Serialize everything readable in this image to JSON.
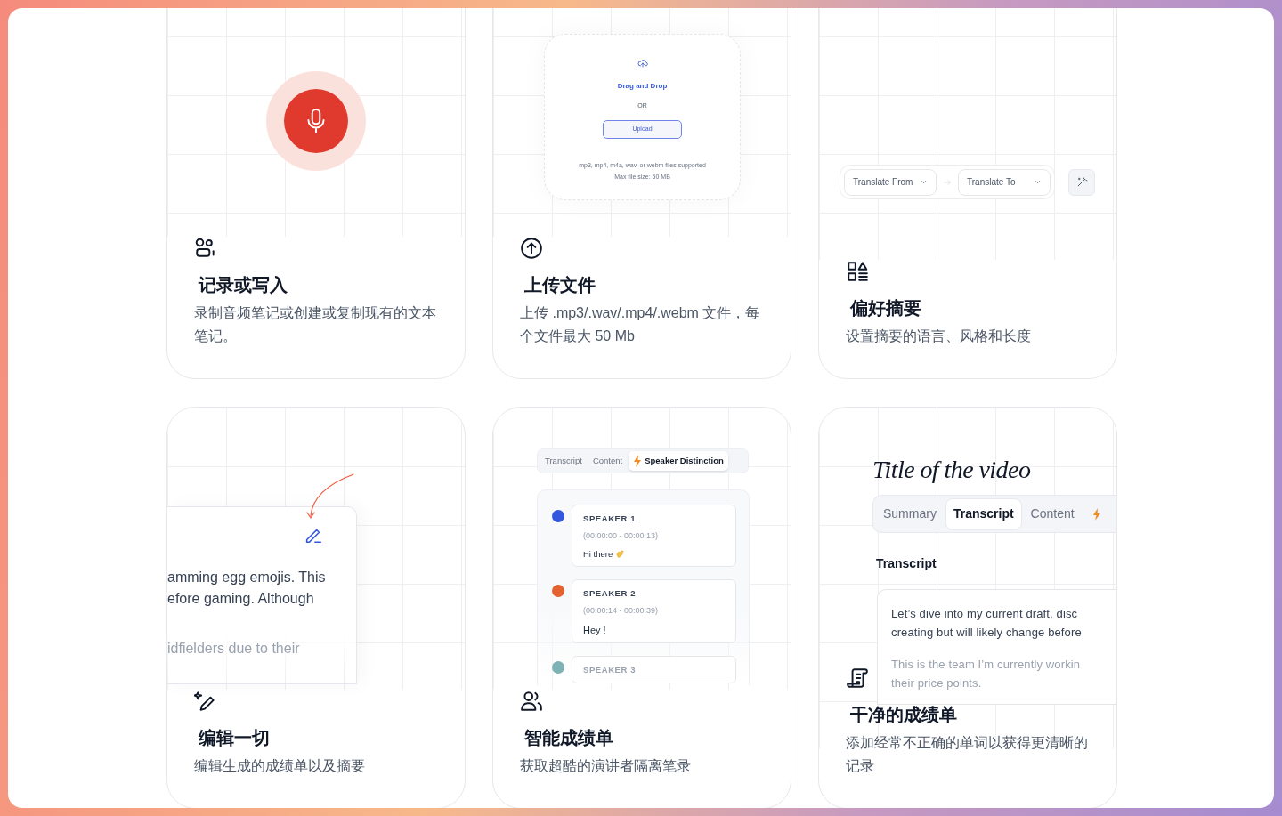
{
  "cards": [
    {
      "kind": "record",
      "title": "记录或写入",
      "description": "录制音频笔记或创建或复制现有的文本笔记。"
    },
    {
      "kind": "upload",
      "title": "上传文件",
      "description": "上传 .mp3/.wav/.mp4/.webm 文件，每个文件最大 50 Mb",
      "upload": {
        "heading": "Drag and Drop",
        "separator": "OR",
        "button": "Upload",
        "notes": [
          "mp3, mp4, m4a, wav, or webm files supported",
          "Max file size: 50 MB"
        ]
      }
    },
    {
      "kind": "translate",
      "title": "偏好摘要",
      "description": "设置摘要的语言、风格和长度",
      "translate": {
        "from": "Translate From",
        "to": "Translate To"
      }
    },
    {
      "kind": "edit",
      "title": "编辑一切",
      "description": "编辑生成的成绩单以及摘要",
      "lines": [
        {
          "text": "amming egg emojis. This",
          "faded": false
        },
        {
          "text": "efore gaming. Although",
          "faded": false
        },
        {
          "text": "idfielders due to their",
          "faded": true
        }
      ]
    },
    {
      "kind": "speakers",
      "title": "智能成绩单",
      "description": "获取超酷的演讲者隔离笔录",
      "tabs": [
        {
          "label": "Transcript",
          "selected": false,
          "bolt": false
        },
        {
          "label": "Content",
          "selected": false,
          "bolt": false
        },
        {
          "label": "Speaker Distinction",
          "selected": true,
          "bolt": true
        }
      ],
      "speakers": [
        {
          "name": "SPEAKER 1",
          "time": "(00:00:00 - 00:00:13)",
          "text": "Hi there",
          "color": "#3457e0",
          "faded": false
        },
        {
          "name": "SPEAKER 2",
          "time": "(00:00:14 - 00:00:39)",
          "text": "Hey !",
          "color": "#e4622f",
          "faded": false
        },
        {
          "name": "SPEAKER 3",
          "color": "#7fb2b4",
          "faded": true
        }
      ]
    },
    {
      "kind": "video",
      "title": "干净的成绩单",
      "description": "添加经常不正确的单词以获得更清晰的记录",
      "video": {
        "title": "Title of the video",
        "tabs": [
          {
            "label": "Summary",
            "selected": false
          },
          {
            "label": "Transcript",
            "selected": true
          },
          {
            "label": "Content",
            "selected": false
          }
        ],
        "section": "Transcript",
        "lines": [
          {
            "text": "Let’s dive into my current draft, disc",
            "faded": false
          },
          {
            "text": "creating but will likely change before",
            "faded": false
          },
          {
            "text": "This is the team I’m currently workin",
            "faded": true
          },
          {
            "text": "their price points.",
            "faded": true
          }
        ]
      }
    }
  ]
}
